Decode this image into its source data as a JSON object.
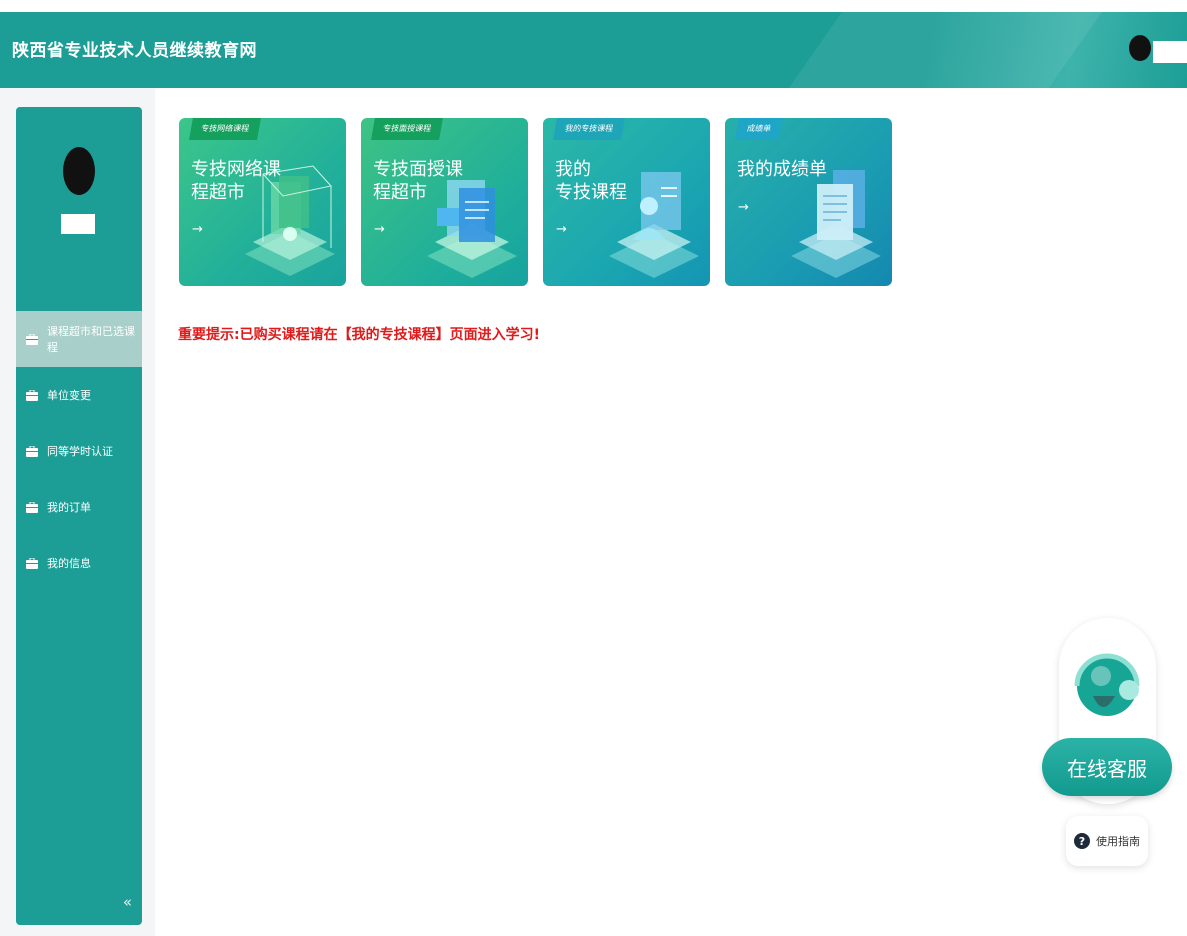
{
  "header": {
    "site_title": "陕西省专业技术人员继续教育网"
  },
  "sidebar": {
    "items": [
      {
        "label": "课程超市和已选课程",
        "active": true,
        "icon": "briefcase-icon"
      },
      {
        "label": "单位变更",
        "active": false,
        "icon": "briefcase-icon"
      },
      {
        "label": "同等学时认证",
        "active": false,
        "icon": "briefcase-icon"
      },
      {
        "label": "我的订单",
        "active": false,
        "icon": "briefcase-icon"
      },
      {
        "label": "我的信息",
        "active": false,
        "icon": "briefcase-icon"
      }
    ],
    "collapse_label": "«"
  },
  "cards": [
    {
      "tag": "专技网络课程",
      "title": "专技网络课\n程超市",
      "arrow": "→"
    },
    {
      "tag": "专技面授课程",
      "title": "专技面授课\n程超市",
      "arrow": "→"
    },
    {
      "tag": "我的专技课程",
      "title": "我的\n专技课程",
      "arrow": "→"
    },
    {
      "tag": "成绩单",
      "title": "我的成绩单",
      "arrow": "→"
    }
  ],
  "notice": "重要提示:已购买课程请在【我的专技课程】页面进入学习!",
  "support": {
    "label": "在线客服",
    "guide_label": "使用指南",
    "guide_icon": "?"
  },
  "colors": {
    "brand": "#1c9e96",
    "notice": "#e01a1a",
    "active_item": "#a8cfc9"
  }
}
